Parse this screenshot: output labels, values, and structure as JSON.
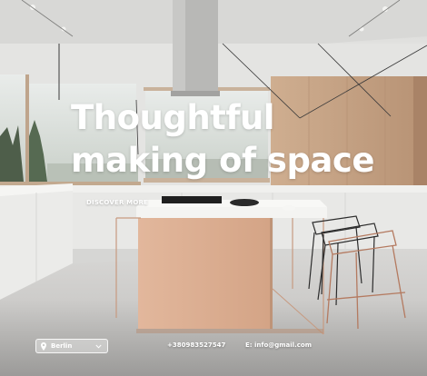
{
  "hero": {
    "headline_line1": "Thoughtful",
    "headline_line2": "making of space",
    "cta_label": "DISCOVER MORE"
  },
  "footer": {
    "location_label": "Berlin",
    "phone": "+380983527547",
    "email": "E: info@gmail.com"
  },
  "icons": {
    "location": "map-pin-icon",
    "dropdown": "chevron-down-icon"
  },
  "colors": {
    "text": "#ffffff",
    "ceiling": "#dcdcda",
    "wood": "#c9a88a",
    "counter": "#f2f2f0",
    "island": "#d9ad93",
    "floor": "#cfcecc"
  }
}
